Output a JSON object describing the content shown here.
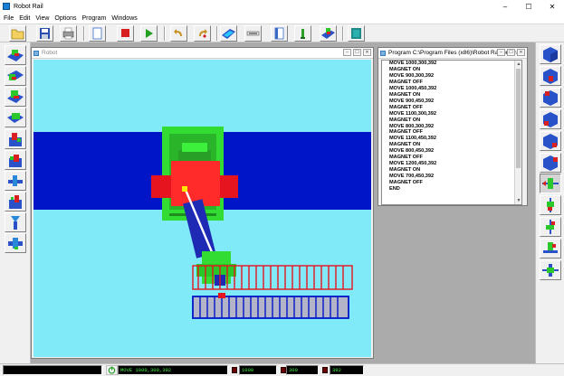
{
  "window": {
    "title": "Robot Rail",
    "controls": [
      "–",
      "☐",
      "✕"
    ]
  },
  "menu": [
    "File",
    "Edit",
    "View",
    "Options",
    "Program",
    "Windows"
  ],
  "toolbar": {
    "buttons": [
      "open-folder-icon",
      "save-icon",
      "print-icon",
      "new-program-icon",
      "stop-icon",
      "run-icon",
      "undo-icon",
      "redo-icon",
      "rail-view-icon",
      "gripper-icon",
      "blank-page-icon",
      "marker-icon",
      "robot-3d-icon",
      "tag-icon"
    ]
  },
  "robot_window": {
    "title": "Robot",
    "controls": [
      "–",
      "☐",
      "✕"
    ]
  },
  "program_window": {
    "title": "Program C:\\Program Files (x86)\\Robot Rail\\progra...",
    "controls": [
      "–",
      "☐",
      "✕"
    ],
    "lines": [
      "MOVE 1000,300,392",
      "MAGNET ON",
      "MOVE 900,300,392",
      "MAGNET OFF",
      "MOVE 1000,450,392",
      "MAGNET ON",
      "MOVE 900,450,392",
      "MAGNET OFF",
      "MOVE 1100,300,392",
      "MAGNET ON",
      "MOVE 800,300,392",
      "MAGNET OFF",
      "MOVE 1100,450,392",
      "MAGNET ON",
      "MOVE 800,450,392",
      "MAGNET OFF",
      "MOVE 1200,450,392",
      "MAGNET ON",
      "MOVE 700,450,392",
      "MAGNET OFF",
      "END"
    ]
  },
  "status": {
    "command": "MOVE 1000,300,392",
    "x": "1000",
    "y": "300",
    "z": "392"
  },
  "colors": {
    "viewport_bg": "#80eaf8",
    "rail_blue": "#0014c8",
    "robot_red": "#e6141e",
    "robot_green": "#32dc32",
    "lcd_text": "#46f046"
  }
}
